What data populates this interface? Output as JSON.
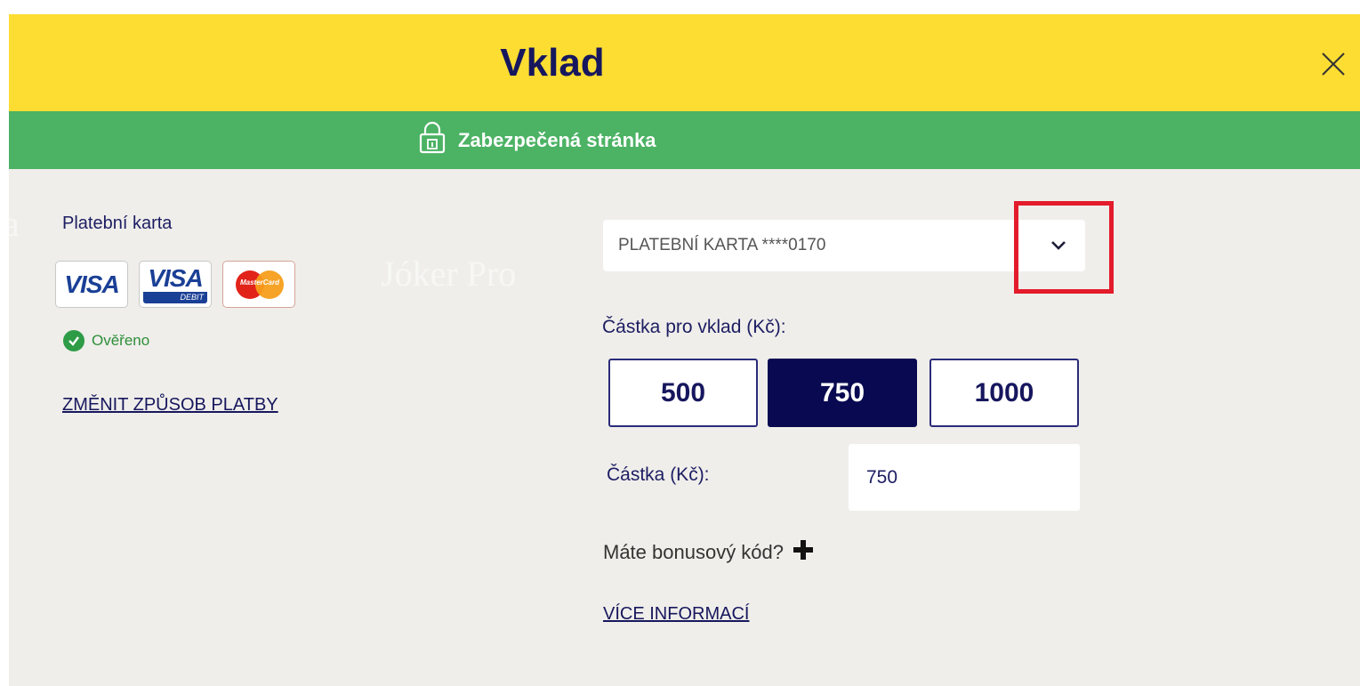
{
  "header": {
    "title": "Vklad",
    "close_icon": "close-icon"
  },
  "secure_bar": {
    "text": "Zabezpečená stránka",
    "icon": "lock-icon"
  },
  "background_ghost": {
    "left_text": "a",
    "right_text": "Jóker Pro"
  },
  "payment": {
    "title": "Platební karta",
    "cards": [
      {
        "name": "visa-logo",
        "text": "VISA"
      },
      {
        "name": "visa-debit-logo",
        "text": "VISA",
        "sub": "DEBIT"
      },
      {
        "name": "mastercard-logo",
        "text": "MasterCard"
      }
    ],
    "verified_text": "Ověřeno",
    "change_link": "ZMĚNIT ZPŮSOB PLATBY"
  },
  "card_select": {
    "value": "PLATEBNÍ KARTA ****0170",
    "icon": "chevron-down-icon"
  },
  "amount": {
    "label": "Částka pro vklad  (Kč):",
    "options": [
      "500",
      "750",
      "1000"
    ],
    "selected": "750",
    "field_label": "Částka (Kč):",
    "field_value": "750"
  },
  "bonus": {
    "text": "Máte bonusový kód?",
    "icon": "plus-icon"
  },
  "more_info": "VÍCE INFORMACÍ",
  "colors": {
    "header_bg": "#fddd32",
    "secure_bg": "#4cb264",
    "navy": "#17175e",
    "selected_bg": "#090952",
    "highlight": "#e31b2a"
  }
}
